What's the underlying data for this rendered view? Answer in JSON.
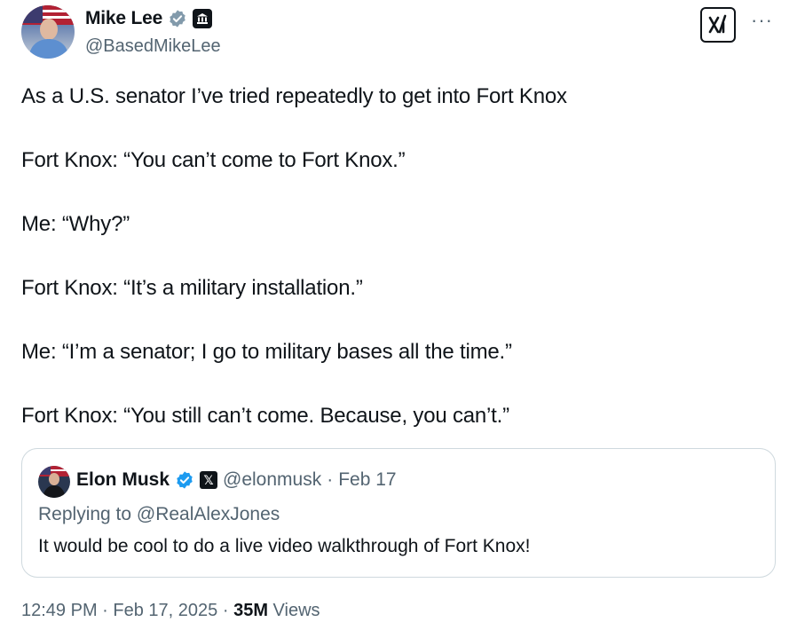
{
  "author": {
    "display_name": "Mike Lee",
    "handle": "@BasedMikeLee",
    "verified_color": "#829aab"
  },
  "tweet": {
    "paragraphs": [
      "As a U.S. senator I’ve tried repeatedly to get into Fort Knox",
      "Fort Knox: “You can’t come to Fort Knox.”",
      "Me: “Why?”",
      "Fort Knox: “It’s a military installation.”",
      "Me: “I’m a senator; I go to military bases all the time.”",
      "Fort Knox: “You still can’t come. Because, you can’t.”"
    ]
  },
  "quoted_tweet": {
    "display_name": "Elon Musk",
    "handle": "@elonmusk",
    "separator": "·",
    "date": "Feb 17",
    "replying_to": "Replying to @RealAlexJones",
    "text": "It would be cool to do a live video walkthrough of Fort Knox!",
    "verified_color": "#1d9bf0"
  },
  "meta": {
    "time": "12:49 PM",
    "separator": "·",
    "date": "Feb 17, 2025",
    "views_count": "35M",
    "views_label": "Views"
  },
  "icons": {
    "author_badge": "government-building-icon",
    "grok": "grok-icon",
    "more": "more-icon",
    "more_glyph": "···",
    "quoted_badge": "x-logo-icon",
    "x_glyph": "𝕏"
  }
}
